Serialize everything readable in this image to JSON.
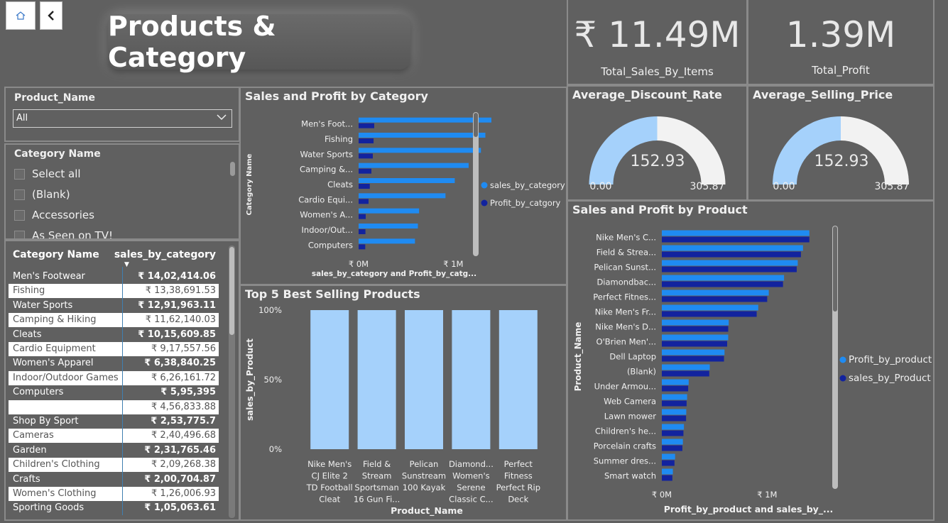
{
  "page": {
    "title": "Products & Category"
  },
  "nav": {
    "home_icon": "home-icon",
    "back_icon": "chevron-left-icon"
  },
  "kpis": {
    "total_sales": {
      "value": "₹ 11.49M",
      "label": "Total_Sales_By_Items"
    },
    "total_profit": {
      "value": "1.39M",
      "label": "Total_Profit"
    }
  },
  "gauges": [
    {
      "title": "Average_Discount_Rate",
      "value": "152.93",
      "min": "0.00",
      "max": "305.87",
      "fraction": 0.5
    },
    {
      "title": "Average_Selling_Price",
      "value": "152.93",
      "min": "0.00",
      "max": "305.87",
      "fraction": 0.5
    }
  ],
  "slicers": {
    "product": {
      "label": "Product_Name",
      "selected": "All"
    },
    "category": {
      "label": "Category Name",
      "items": [
        "Select all",
        "(Blank)",
        "Accessories",
        "As Seen on TV!"
      ]
    }
  },
  "table": {
    "headers": [
      "Category Name",
      "sales_by_category"
    ],
    "rows": [
      [
        "Men's Footwear",
        "₹ 14,02,414.06"
      ],
      [
        "Fishing",
        "₹ 13,38,691.53"
      ],
      [
        "Water Sports",
        "₹ 12,91,963.11"
      ],
      [
        "Camping & Hiking",
        "₹ 11,62,140.03"
      ],
      [
        "Cleats",
        "₹ 10,15,609.85"
      ],
      [
        "Cardio Equipment",
        "₹ 9,17,557.56"
      ],
      [
        "Women's Apparel",
        "₹ 6,38,840.25"
      ],
      [
        "Indoor/Outdoor Games",
        "₹ 6,26,161.72"
      ],
      [
        "Computers",
        "₹ 5,95,395"
      ],
      [
        "",
        "₹ 4,56,833.88"
      ],
      [
        "Shop By Sport",
        "₹ 2,53,775.7"
      ],
      [
        "Cameras",
        "₹ 2,40,496.68"
      ],
      [
        "Garden",
        "₹ 2,31,765.46"
      ],
      [
        "Children's Clothing",
        "₹ 2,09,268.38"
      ],
      [
        "Crafts",
        "₹ 2,00,704.87"
      ],
      [
        "Women's Clothing",
        "₹ 1,26,006.93"
      ],
      [
        "Sporting Goods",
        "₹ 1,05,063.61"
      ]
    ]
  },
  "colors": {
    "sales": "#1f8bf2",
    "profit": "#12239e",
    "light_bar": "#a5d1fb",
    "gauge_fill": "#a5d1fb",
    "gauge_bg": "#f2f2f2"
  },
  "chart_data": [
    {
      "id": "category",
      "type": "bar",
      "orientation": "horizontal",
      "title": "Sales and Profit by Category",
      "ylabel": "Category Name",
      "xlabel": "sales_by_category and Profit_by_catg...",
      "categories": [
        "Men's Foot...",
        "Fishing",
        "Water Sports",
        "Camping &...",
        "Cleats",
        "Cardio Equi...",
        "Women's A...",
        "Indoor/Out...",
        "Computers"
      ],
      "series": [
        {
          "name": "sales_by_category",
          "values": [
            1402414,
            1338692,
            1291963,
            1162140,
            1015610,
            917558,
            638840,
            626162,
            595395
          ]
        },
        {
          "name": "Profit_by_catgory",
          "values": [
            165000,
            158000,
            150000,
            135000,
            118000,
            105000,
            75000,
            72000,
            70000
          ]
        }
      ],
      "xticks": [
        "₹ 0M",
        "₹ 1M"
      ],
      "xlim": [
        0,
        1500000
      ],
      "legend": "right"
    },
    {
      "id": "top5",
      "type": "bar",
      "title": "Top 5 Best Selling Products",
      "ylabel": "sales_by_Product",
      "xlabel": "Product_Name",
      "categories": [
        "Nike Men's CJ Elite 2 TD Football Cleat",
        "Field & Stream Sportsman 16 Gun Fi...",
        "Pelican Sunstream 100 Kayak",
        "Diamond... Women's Serene Classic C...",
        "Perfect Fitness Perfect Rip Deck"
      ],
      "values": [
        100,
        100,
        100,
        100,
        100
      ],
      "yticks": [
        "100%",
        "50%",
        "0%"
      ],
      "ylim": [
        0,
        100
      ]
    },
    {
      "id": "product",
      "type": "bar",
      "orientation": "horizontal",
      "title": "Sales and Profit by Product",
      "ylabel": "Product_Name",
      "xlabel": "Profit_by_product and sales_by_...",
      "categories": [
        "Nike Men's C...",
        "Field & Strea...",
        "Pelican Sunst...",
        "Diamondbac...",
        "Perfect Fitnes...",
        "Nike Men's Fr...",
        "Nike Men's D...",
        "O'Brien Men'...",
        "Dell Laptop",
        "(Blank)",
        "Under Armou...",
        "Web Camera",
        "Lawn mower",
        "Children's he...",
        "Porcelain crafts",
        "Summer dres...",
        "Smart watch"
      ],
      "series": [
        {
          "name": "Profit_by_product",
          "values": [
            1400000,
            1340000,
            1290000,
            1160000,
            1015000,
            915000,
            635000,
            630000,
            595000,
            455000,
            255000,
            240000,
            232000,
            210000,
            200000,
            126000,
            105000
          ]
        },
        {
          "name": "sales_by_Product",
          "values": [
            1400000,
            1320000,
            1280000,
            1150000,
            1000000,
            900000,
            630000,
            620000,
            590000,
            450000,
            250000,
            235000,
            230000,
            205000,
            195000,
            120000,
            100000
          ]
        }
      ],
      "xticks": [
        "₹ 0M",
        "₹ 1M"
      ],
      "xlim": [
        0,
        1550000
      ],
      "legend": "right"
    }
  ]
}
